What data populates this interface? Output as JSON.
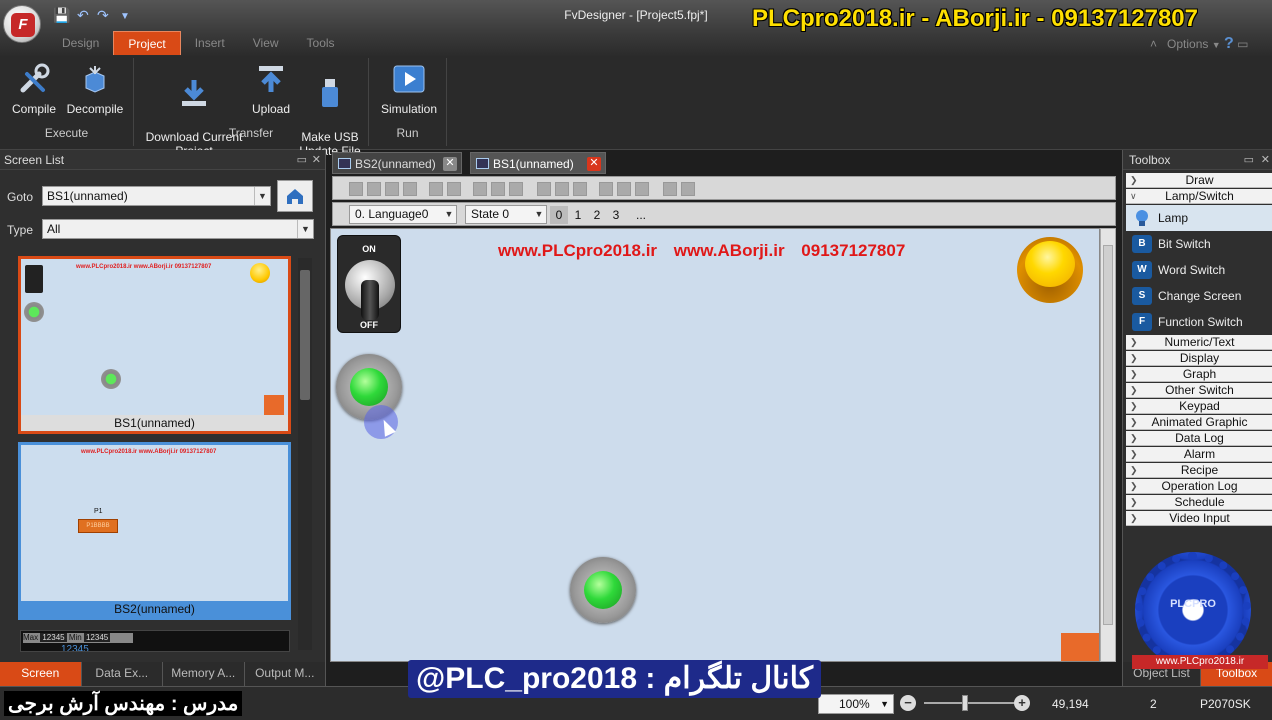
{
  "app": {
    "window_title": "FvDesigner - [Project5.fpj*]",
    "logo_letter": "F",
    "watermark": "PLCpro2018.ir - ABorji.ir - 09137127807"
  },
  "menu": {
    "tabs": [
      {
        "label": "Design"
      },
      {
        "label": "Project"
      },
      {
        "label": "Insert"
      },
      {
        "label": "View"
      },
      {
        "label": "Tools"
      }
    ],
    "active": "Project",
    "options_label": "Options"
  },
  "ribbon": {
    "groups": [
      {
        "label": "Execute",
        "buttons": [
          {
            "label": "Compile"
          },
          {
            "label": "Decompile"
          }
        ]
      },
      {
        "label": "Transfer",
        "buttons": [
          {
            "label": "Download Current\nProject"
          },
          {
            "label": "Upload"
          },
          {
            "label": "Make USB\nUpdate File"
          }
        ]
      },
      {
        "label": "Run",
        "buttons": [
          {
            "label": "Simulation"
          }
        ]
      }
    ]
  },
  "screen_list": {
    "title": "Screen List",
    "goto_label": "Goto",
    "goto_value": "BS1(unnamed)",
    "type_label": "Type",
    "type_value": "All",
    "thumbs": [
      {
        "label": "BS1(unnamed)",
        "watermark": "www.PLCpro2018.ir   www.ABorji.ir   09137127807"
      },
      {
        "label": "BS2(unnamed)",
        "watermark": "www.PLCpro2018.ir   www.ABorji.ir   09137127807",
        "p1_label": "P1",
        "p1_button": "P1BBBB"
      }
    ],
    "third_thumb": {
      "max_label": "Max",
      "max_value": "12345",
      "min_label": "Min",
      "min_value": "12345",
      "digits": "12345"
    },
    "bottom_tabs": [
      {
        "label": "Screen"
      },
      {
        "label": "Data Ex..."
      },
      {
        "label": "Memory A..."
      },
      {
        "label": "Output M..."
      }
    ]
  },
  "editor": {
    "tabs": [
      {
        "label": "BS2(unnamed)"
      },
      {
        "label": "BS1(unnamed)"
      }
    ],
    "active_tab": "BS1(unnamed)",
    "language_select": "0.  Language0",
    "state_select": "State 0",
    "state_numbers": [
      "0",
      "1",
      "2",
      "3"
    ],
    "more_label": "...",
    "canvas_watermark": "www.PLCpro2018.ir   www.ABorji.ir   09137127807",
    "toggle_on": "ON",
    "toggle_off": "OFF"
  },
  "toolbox": {
    "title": "Toolbox",
    "categories_top": [
      {
        "label": "Draw"
      },
      {
        "label": "Lamp/Switch"
      }
    ],
    "items": [
      {
        "label": "Lamp",
        "icon": "lamp-icon",
        "glyph": ""
      },
      {
        "label": "Bit Switch",
        "icon": "bit-switch-icon",
        "glyph": "B"
      },
      {
        "label": "Word Switch",
        "icon": "word-switch-icon",
        "glyph": "W"
      },
      {
        "label": "Change Screen",
        "icon": "change-screen-icon",
        "glyph": "S"
      },
      {
        "label": "Function Switch",
        "icon": "function-switch-icon",
        "glyph": "F"
      }
    ],
    "categories": [
      {
        "label": "Numeric/Text"
      },
      {
        "label": "Display"
      },
      {
        "label": "Graph"
      },
      {
        "label": "Other Switch"
      },
      {
        "label": "Keypad"
      },
      {
        "label": "Animated Graphic"
      },
      {
        "label": "Data Log"
      },
      {
        "label": "Alarm"
      },
      {
        "label": "Recipe"
      },
      {
        "label": "Operation Log"
      },
      {
        "label": "Schedule"
      },
      {
        "label": "Video Input"
      }
    ],
    "gear_logo_text": "PLCPRO",
    "site_badge": "www.PLCpro2018.ir",
    "bottom_tabs": [
      {
        "label": "Object List"
      },
      {
        "label": "Toolbox"
      }
    ]
  },
  "status": {
    "persian_instructor": "مدرس : مهندس آرش برجی",
    "telegram": "@PLC_pro2018 : کانال تلگرام",
    "zoom": "100%",
    "coords": "49,194",
    "pages": "2",
    "model": "P2070SK"
  },
  "colors": {
    "accent": "#d94a16",
    "canvas": "#cddcec",
    "watermark_red": "#e01818",
    "watermark_yellow": "#ffe000"
  }
}
